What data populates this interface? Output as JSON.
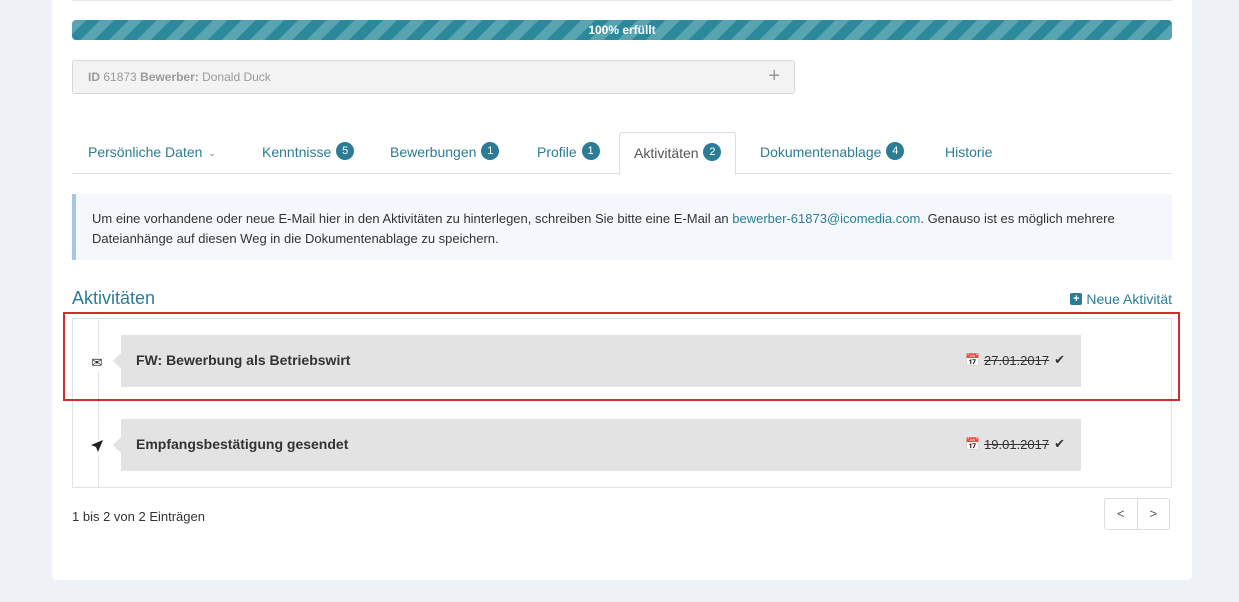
{
  "progress": {
    "label": "100% erfüllt",
    "percent": 100
  },
  "candidate": {
    "id_label": "ID",
    "id_value": "61873",
    "role_label": "Bewerber:",
    "name": "Donald Duck",
    "add_icon": "plus-icon"
  },
  "tabs": [
    {
      "label": "Persönliche Daten",
      "badge": "",
      "has_chevron": true
    },
    {
      "label": "Kenntnisse",
      "badge": "5"
    },
    {
      "label": "Bewerbungen",
      "badge": "1"
    },
    {
      "label": "Profile",
      "badge": "1"
    },
    {
      "label": "Aktivitäten",
      "badge": "2",
      "active": true
    },
    {
      "label": "Dokumentenablage",
      "badge": "4"
    },
    {
      "label": "Historie",
      "badge": ""
    }
  ],
  "info": {
    "text_before": "Um eine vorhandene oder neue E-Mail hier in den Aktivitäten zu hinterlegen, schreiben Sie bitte eine E-Mail an ",
    "email": "bewerber-61873@icomedia.com",
    "text_after": ". Genauso ist es möglich mehrere Dateianhänge auf diesen Weg in die Dokumentenablage zu speichern."
  },
  "section": {
    "title": "Aktivitäten",
    "new_label": "Neue Aktivität"
  },
  "activities": [
    {
      "icon": "envelope-icon",
      "title": "FW: Bewerbung als Betriebswirt",
      "date": "27.01.2017"
    },
    {
      "icon": "paper-plane-icon",
      "title": "Empfangsbestätigung gesendet",
      "date": "19.01.2017"
    }
  ],
  "footer": {
    "count_text": "1 bis 2 von 2 Einträgen",
    "prev": "<",
    "next": ">"
  },
  "colors": {
    "accent": "#2a7d95",
    "highlight": "#d42b2b"
  }
}
